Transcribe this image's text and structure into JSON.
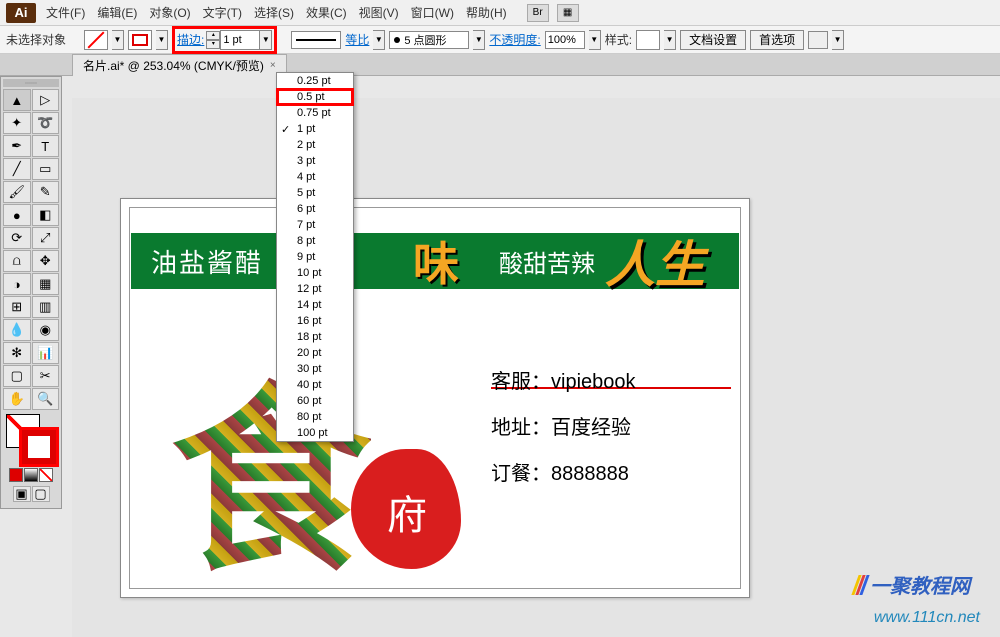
{
  "menubar": {
    "items": [
      "文件(F)",
      "编辑(E)",
      "对象(O)",
      "文字(T)",
      "选择(S)",
      "效果(C)",
      "视图(V)",
      "窗口(W)",
      "帮助(H)"
    ]
  },
  "controlbar": {
    "selection": "未选择对象",
    "stroke_label": "描边:",
    "stroke_value": "1 pt",
    "profile_label": "等比",
    "brush_label": "5 点圆形",
    "opacity_label": "不透明度:",
    "opacity_value": "100%",
    "style_label": "样式:",
    "docsetup": "文档设置",
    "preferences": "首选项"
  },
  "doctab": {
    "title": "名片.ai* @ 253.04% (CMYK/预览)"
  },
  "dropdown": {
    "items": [
      "0.25 pt",
      "0.5 pt",
      "0.75 pt",
      "1 pt",
      "2 pt",
      "3 pt",
      "4 pt",
      "5 pt",
      "6 pt",
      "7 pt",
      "8 pt",
      "9 pt",
      "10 pt",
      "12 pt",
      "14 pt",
      "16 pt",
      "18 pt",
      "20 pt",
      "30 pt",
      "40 pt",
      "60 pt",
      "80 pt",
      "100 pt"
    ],
    "checked_index": 3,
    "highlight_index": 1
  },
  "artwork": {
    "band1": "油盐酱醋",
    "band_wei": "味",
    "band2": "酸甜苦辣",
    "band_rs": "人生",
    "big_char": "食",
    "fu": "府",
    "info_l1_label": "客服：",
    "info_l1_val": "vipiebook",
    "info_l2_label": "地址：",
    "info_l2_val": "百度经验",
    "info_l3_label": "订餐：",
    "info_l3_val": "8888888"
  },
  "watermark": {
    "url": "www.111cn.net",
    "brand": "一聚教程网"
  }
}
